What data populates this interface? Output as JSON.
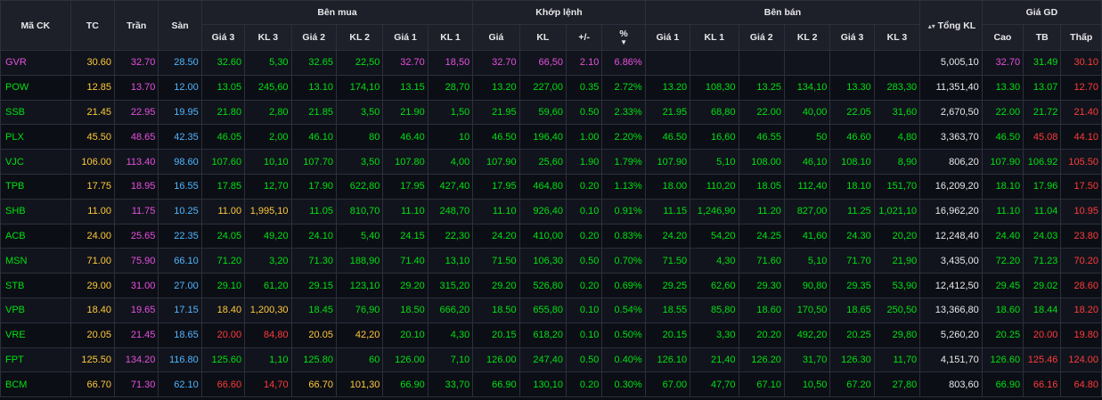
{
  "colors": {
    "up": "#00e012",
    "down": "#ff3b3b",
    "ref": "#ffc93a",
    "ceil": "#e64fe0",
    "floor": "#4fb6ff",
    "neutral": "#e8e8ea"
  },
  "header": {
    "symbol": "Mã CK",
    "ref": "TC",
    "ceil": "Trần",
    "floor": "Sàn",
    "buy_group": "Bên mua",
    "match_group": "Khớp lệnh",
    "sell_group": "Bên bán",
    "total_vol": "Tổng KL",
    "price_group": "Giá GD",
    "buy_cols": [
      "Giá 3",
      "KL 3",
      "Giá 2",
      "KL 2",
      "Giá 1",
      "KL 1"
    ],
    "match_cols": [
      "Giá",
      "KL",
      "+/-",
      "%"
    ],
    "sell_cols": [
      "Giá 1",
      "KL 1",
      "Giá 2",
      "KL 2",
      "Giá 3",
      "KL 3"
    ],
    "price_cols": [
      "Cao",
      "TB",
      "Thấp"
    ],
    "sort_icon": "▼",
    "updown_icon": "▴▾"
  },
  "rows": [
    {
      "sym": "GVR",
      "sc": "ceil",
      "tc": "30.60",
      "tran": "32.70",
      "san": "28.50",
      "buy": [
        [
          "32.60",
          "up"
        ],
        [
          "5,30",
          "up"
        ],
        [
          "32.65",
          "up"
        ],
        [
          "22,50",
          "up"
        ],
        [
          "32.70",
          "ceil"
        ],
        [
          "18,50",
          "ceil"
        ]
      ],
      "match": [
        [
          "32.70",
          "ceil"
        ],
        [
          "66,50",
          "ceil"
        ],
        [
          "2.10",
          "ceil"
        ],
        [
          "6.86%",
          "ceil"
        ]
      ],
      "sell": [
        [
          "",
          ""
        ],
        [
          "",
          ""
        ],
        [
          "",
          ""
        ],
        [
          "",
          ""
        ],
        [
          "",
          ""
        ],
        [
          "",
          ""
        ]
      ],
      "total": "5,005,10",
      "gd": [
        [
          "32.70",
          "ceil"
        ],
        [
          "31.49",
          "up"
        ],
        [
          "30.10",
          "down"
        ]
      ]
    },
    {
      "sym": "POW",
      "sc": "up",
      "tc": "12.85",
      "tran": "13.70",
      "san": "12.00",
      "buy": [
        [
          "13.05",
          "up"
        ],
        [
          "245,60",
          "up"
        ],
        [
          "13.10",
          "up"
        ],
        [
          "174,10",
          "up"
        ],
        [
          "13.15",
          "up"
        ],
        [
          "28,70",
          "up"
        ]
      ],
      "match": [
        [
          "13.20",
          "up"
        ],
        [
          "227,00",
          "up"
        ],
        [
          "0.35",
          "up"
        ],
        [
          "2.72%",
          "up"
        ]
      ],
      "sell": [
        [
          "13.20",
          "up"
        ],
        [
          "108,30",
          "up"
        ],
        [
          "13.25",
          "up"
        ],
        [
          "134,10",
          "up"
        ],
        [
          "13.30",
          "up"
        ],
        [
          "283,30",
          "up"
        ]
      ],
      "total": "11,351,40",
      "gd": [
        [
          "13.30",
          "up"
        ],
        [
          "13.07",
          "up"
        ],
        [
          "12.70",
          "down"
        ]
      ]
    },
    {
      "sym": "SSB",
      "sc": "up",
      "tc": "21.45",
      "tran": "22.95",
      "san": "19.95",
      "buy": [
        [
          "21.80",
          "up"
        ],
        [
          "2,80",
          "up"
        ],
        [
          "21.85",
          "up"
        ],
        [
          "3,50",
          "up"
        ],
        [
          "21.90",
          "up"
        ],
        [
          "1,50",
          "up"
        ]
      ],
      "match": [
        [
          "21.95",
          "up"
        ],
        [
          "59,60",
          "up"
        ],
        [
          "0.50",
          "up"
        ],
        [
          "2.33%",
          "up"
        ]
      ],
      "sell": [
        [
          "21.95",
          "up"
        ],
        [
          "68,80",
          "up"
        ],
        [
          "22.00",
          "up"
        ],
        [
          "40,00",
          "up"
        ],
        [
          "22.05",
          "up"
        ],
        [
          "31,60",
          "up"
        ]
      ],
      "total": "2,670,50",
      "gd": [
        [
          "22.00",
          "up"
        ],
        [
          "21.72",
          "up"
        ],
        [
          "21.40",
          "down"
        ]
      ]
    },
    {
      "sym": "PLX",
      "sc": "up",
      "tc": "45.50",
      "tran": "48.65",
      "san": "42.35",
      "buy": [
        [
          "46.05",
          "up"
        ],
        [
          "2,00",
          "up"
        ],
        [
          "46.10",
          "up"
        ],
        [
          "80",
          "up"
        ],
        [
          "46.40",
          "up"
        ],
        [
          "10",
          "up"
        ]
      ],
      "match": [
        [
          "46.50",
          "up"
        ],
        [
          "196,40",
          "up"
        ],
        [
          "1.00",
          "up"
        ],
        [
          "2.20%",
          "up"
        ]
      ],
      "sell": [
        [
          "46.50",
          "up"
        ],
        [
          "16,60",
          "up"
        ],
        [
          "46.55",
          "up"
        ],
        [
          "50",
          "up"
        ],
        [
          "46.60",
          "up"
        ],
        [
          "4,80",
          "up"
        ]
      ],
      "total": "3,363,70",
      "gd": [
        [
          "46.50",
          "up"
        ],
        [
          "45.08",
          "down"
        ],
        [
          "44.10",
          "down"
        ]
      ]
    },
    {
      "sym": "VJC",
      "sc": "up",
      "tc": "106.00",
      "tran": "113.40",
      "san": "98.60",
      "buy": [
        [
          "107.60",
          "up"
        ],
        [
          "10,10",
          "up"
        ],
        [
          "107.70",
          "up"
        ],
        [
          "3,50",
          "up"
        ],
        [
          "107.80",
          "up"
        ],
        [
          "4,00",
          "up"
        ]
      ],
      "match": [
        [
          "107.90",
          "up"
        ],
        [
          "25,60",
          "up"
        ],
        [
          "1.90",
          "up"
        ],
        [
          "1.79%",
          "up"
        ]
      ],
      "sell": [
        [
          "107.90",
          "up"
        ],
        [
          "5,10",
          "up"
        ],
        [
          "108.00",
          "up"
        ],
        [
          "46,10",
          "up"
        ],
        [
          "108.10",
          "up"
        ],
        [
          "8,90",
          "up"
        ]
      ],
      "total": "806,20",
      "gd": [
        [
          "107.90",
          "up"
        ],
        [
          "106.92",
          "up"
        ],
        [
          "105.50",
          "down"
        ]
      ]
    },
    {
      "sym": "TPB",
      "sc": "up",
      "tc": "17.75",
      "tran": "18.95",
      "san": "16.55",
      "buy": [
        [
          "17.85",
          "up"
        ],
        [
          "12,70",
          "up"
        ],
        [
          "17.90",
          "up"
        ],
        [
          "622,80",
          "up"
        ],
        [
          "17.95",
          "up"
        ],
        [
          "427,40",
          "up"
        ]
      ],
      "match": [
        [
          "17.95",
          "up"
        ],
        [
          "464,80",
          "up"
        ],
        [
          "0.20",
          "up"
        ],
        [
          "1.13%",
          "up"
        ]
      ],
      "sell": [
        [
          "18.00",
          "up"
        ],
        [
          "110,20",
          "up"
        ],
        [
          "18.05",
          "up"
        ],
        [
          "112,40",
          "up"
        ],
        [
          "18.10",
          "up"
        ],
        [
          "151,70",
          "up"
        ]
      ],
      "total": "16,209,20",
      "gd": [
        [
          "18.10",
          "up"
        ],
        [
          "17.96",
          "up"
        ],
        [
          "17.50",
          "down"
        ]
      ]
    },
    {
      "sym": "SHB",
      "sc": "up",
      "tc": "11.00",
      "tran": "11.75",
      "san": "10.25",
      "buy": [
        [
          "11.00",
          "ref"
        ],
        [
          "1,995,10",
          "ref"
        ],
        [
          "11.05",
          "up"
        ],
        [
          "810,70",
          "up"
        ],
        [
          "11.10",
          "up"
        ],
        [
          "248,70",
          "up"
        ]
      ],
      "match": [
        [
          "11.10",
          "up"
        ],
        [
          "926,40",
          "up"
        ],
        [
          "0.10",
          "up"
        ],
        [
          "0.91%",
          "up"
        ]
      ],
      "sell": [
        [
          "11.15",
          "up"
        ],
        [
          "1,246,90",
          "up"
        ],
        [
          "11.20",
          "up"
        ],
        [
          "827,00",
          "up"
        ],
        [
          "11.25",
          "up"
        ],
        [
          "1,021,10",
          "up"
        ]
      ],
      "total": "16,962,20",
      "gd": [
        [
          "11.10",
          "up"
        ],
        [
          "11.04",
          "up"
        ],
        [
          "10.95",
          "down"
        ]
      ]
    },
    {
      "sym": "ACB",
      "sc": "up",
      "tc": "24.00",
      "tran": "25.65",
      "san": "22.35",
      "buy": [
        [
          "24.05",
          "up"
        ],
        [
          "49,20",
          "up"
        ],
        [
          "24.10",
          "up"
        ],
        [
          "5,40",
          "up"
        ],
        [
          "24.15",
          "up"
        ],
        [
          "22,30",
          "up"
        ]
      ],
      "match": [
        [
          "24.20",
          "up"
        ],
        [
          "410,00",
          "up"
        ],
        [
          "0.20",
          "up"
        ],
        [
          "0.83%",
          "up"
        ]
      ],
      "sell": [
        [
          "24.20",
          "up"
        ],
        [
          "54,20",
          "up"
        ],
        [
          "24.25",
          "up"
        ],
        [
          "41,60",
          "up"
        ],
        [
          "24.30",
          "up"
        ],
        [
          "20,20",
          "up"
        ]
      ],
      "total": "12,248,40",
      "gd": [
        [
          "24.40",
          "up"
        ],
        [
          "24.03",
          "up"
        ],
        [
          "23.80",
          "down"
        ]
      ]
    },
    {
      "sym": "MSN",
      "sc": "up",
      "tc": "71.00",
      "tran": "75.90",
      "san": "66.10",
      "buy": [
        [
          "71.20",
          "up"
        ],
        [
          "3,20",
          "up"
        ],
        [
          "71.30",
          "up"
        ],
        [
          "188,90",
          "up"
        ],
        [
          "71.40",
          "up"
        ],
        [
          "13,10",
          "up"
        ]
      ],
      "match": [
        [
          "71.50",
          "up"
        ],
        [
          "106,30",
          "up"
        ],
        [
          "0.50",
          "up"
        ],
        [
          "0.70%",
          "up"
        ]
      ],
      "sell": [
        [
          "71.50",
          "up"
        ],
        [
          "4,30",
          "up"
        ],
        [
          "71.60",
          "up"
        ],
        [
          "5,10",
          "up"
        ],
        [
          "71.70",
          "up"
        ],
        [
          "21,90",
          "up"
        ]
      ],
      "total": "3,435,00",
      "gd": [
        [
          "72.20",
          "up"
        ],
        [
          "71.23",
          "up"
        ],
        [
          "70.20",
          "down"
        ]
      ]
    },
    {
      "sym": "STB",
      "sc": "up",
      "tc": "29.00",
      "tran": "31.00",
      "san": "27.00",
      "buy": [
        [
          "29.10",
          "up"
        ],
        [
          "61,20",
          "up"
        ],
        [
          "29.15",
          "up"
        ],
        [
          "123,10",
          "up"
        ],
        [
          "29.20",
          "up"
        ],
        [
          "315,20",
          "up"
        ]
      ],
      "match": [
        [
          "29.20",
          "up"
        ],
        [
          "526,80",
          "up"
        ],
        [
          "0.20",
          "up"
        ],
        [
          "0.69%",
          "up"
        ]
      ],
      "sell": [
        [
          "29.25",
          "up"
        ],
        [
          "62,60",
          "up"
        ],
        [
          "29.30",
          "up"
        ],
        [
          "90,80",
          "up"
        ],
        [
          "29.35",
          "up"
        ],
        [
          "53,90",
          "up"
        ]
      ],
      "total": "12,412,50",
      "gd": [
        [
          "29.45",
          "up"
        ],
        [
          "29.02",
          "up"
        ],
        [
          "28.60",
          "down"
        ]
      ]
    },
    {
      "sym": "VPB",
      "sc": "up",
      "tc": "18.40",
      "tran": "19.65",
      "san": "17.15",
      "buy": [
        [
          "18.40",
          "ref"
        ],
        [
          "1,200,30",
          "ref"
        ],
        [
          "18.45",
          "up"
        ],
        [
          "76,90",
          "up"
        ],
        [
          "18.50",
          "up"
        ],
        [
          "666,20",
          "up"
        ]
      ],
      "match": [
        [
          "18.50",
          "up"
        ],
        [
          "655,80",
          "up"
        ],
        [
          "0.10",
          "up"
        ],
        [
          "0.54%",
          "up"
        ]
      ],
      "sell": [
        [
          "18.55",
          "up"
        ],
        [
          "85,80",
          "up"
        ],
        [
          "18.60",
          "up"
        ],
        [
          "170,50",
          "up"
        ],
        [
          "18.65",
          "up"
        ],
        [
          "250,50",
          "up"
        ]
      ],
      "total": "13,366,80",
      "gd": [
        [
          "18.60",
          "up"
        ],
        [
          "18.44",
          "up"
        ],
        [
          "18.20",
          "down"
        ]
      ]
    },
    {
      "sym": "VRE",
      "sc": "up",
      "tc": "20.05",
      "tran": "21.45",
      "san": "18.65",
      "buy": [
        [
          "20.00",
          "down"
        ],
        [
          "84,80",
          "down"
        ],
        [
          "20.05",
          "ref"
        ],
        [
          "42,20",
          "ref"
        ],
        [
          "20.10",
          "up"
        ],
        [
          "4,30",
          "up"
        ]
      ],
      "match": [
        [
          "20.15",
          "up"
        ],
        [
          "618,20",
          "up"
        ],
        [
          "0.10",
          "up"
        ],
        [
          "0.50%",
          "up"
        ]
      ],
      "sell": [
        [
          "20.15",
          "up"
        ],
        [
          "3,30",
          "up"
        ],
        [
          "20.20",
          "up"
        ],
        [
          "492,20",
          "up"
        ],
        [
          "20.25",
          "up"
        ],
        [
          "29,80",
          "up"
        ]
      ],
      "total": "5,260,20",
      "gd": [
        [
          "20.25",
          "up"
        ],
        [
          "20.00",
          "down"
        ],
        [
          "19.80",
          "down"
        ]
      ]
    },
    {
      "sym": "FPT",
      "sc": "up",
      "tc": "125.50",
      "tran": "134.20",
      "san": "116.80",
      "buy": [
        [
          "125.60",
          "up"
        ],
        [
          "1,10",
          "up"
        ],
        [
          "125.80",
          "up"
        ],
        [
          "60",
          "up"
        ],
        [
          "126.00",
          "up"
        ],
        [
          "7,10",
          "up"
        ]
      ],
      "match": [
        [
          "126.00",
          "up"
        ],
        [
          "247,40",
          "up"
        ],
        [
          "0.50",
          "up"
        ],
        [
          "0.40%",
          "up"
        ]
      ],
      "sell": [
        [
          "126.10",
          "up"
        ],
        [
          "21,40",
          "up"
        ],
        [
          "126.20",
          "up"
        ],
        [
          "31,70",
          "up"
        ],
        [
          "126.30",
          "up"
        ],
        [
          "11,70",
          "up"
        ]
      ],
      "total": "4,151,70",
      "gd": [
        [
          "126.60",
          "up"
        ],
        [
          "125.46",
          "down"
        ],
        [
          "124.00",
          "down"
        ]
      ]
    },
    {
      "sym": "BCM",
      "sc": "up",
      "tc": "66.70",
      "tran": "71.30",
      "san": "62.10",
      "buy": [
        [
          "66.60",
          "down"
        ],
        [
          "14,70",
          "down"
        ],
        [
          "66.70",
          "ref"
        ],
        [
          "101,30",
          "ref"
        ],
        [
          "66.90",
          "up"
        ],
        [
          "33,70",
          "up"
        ]
      ],
      "match": [
        [
          "66.90",
          "up"
        ],
        [
          "130,10",
          "up"
        ],
        [
          "0.20",
          "up"
        ],
        [
          "0.30%",
          "up"
        ]
      ],
      "sell": [
        [
          "67.00",
          "up"
        ],
        [
          "47,70",
          "up"
        ],
        [
          "67.10",
          "up"
        ],
        [
          "10,50",
          "up"
        ],
        [
          "67.20",
          "up"
        ],
        [
          "27,80",
          "up"
        ]
      ],
      "total": "803,60",
      "gd": [
        [
          "66.90",
          "up"
        ],
        [
          "66.16",
          "down"
        ],
        [
          "64.80",
          "down"
        ]
      ]
    }
  ]
}
